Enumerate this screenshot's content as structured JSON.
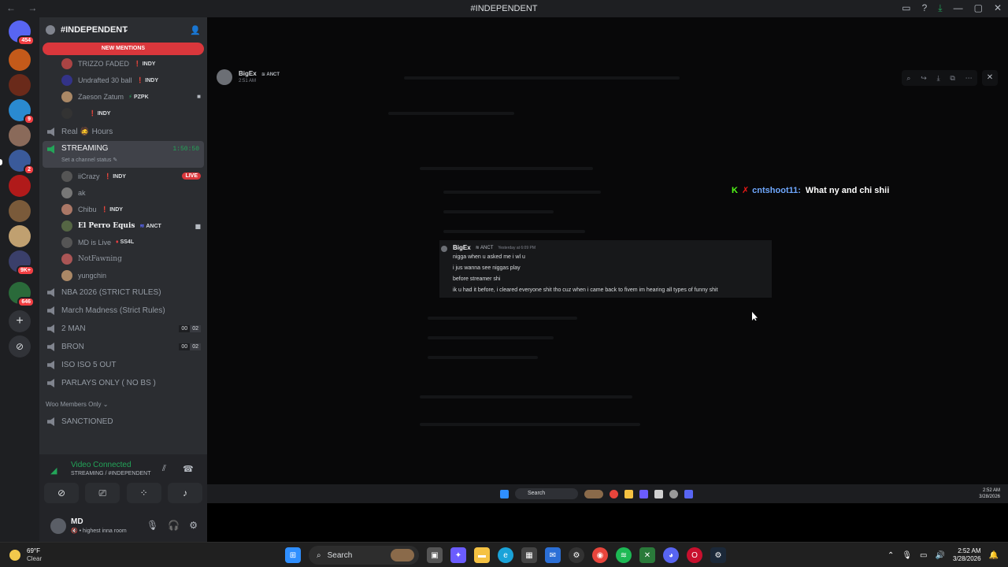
{
  "window": {
    "title": "#INDEPENDENT",
    "nav": "← →"
  },
  "servers": {
    "top_badge": "454",
    "badges": [
      "9",
      "2",
      "9K+",
      "646"
    ],
    "add_icon": "+",
    "discover_icon": "⊘"
  },
  "channel_sidebar": {
    "server_name": "#INDEPENDENT",
    "new_mentions": "NEW MENTIONS",
    "top_users": [
      {
        "name": "TRIZZO FADED",
        "tag": "INDY",
        "color": "#a44"
      },
      {
        "name": "Undrafted 30 ball",
        "tag": "INDY",
        "color": "#338"
      },
      {
        "name": "Zaeson Zatum",
        "tag": "PZPK",
        "color": "#a86"
      },
      {
        "name": "",
        "tag": "INDY",
        "color": "#333"
      }
    ],
    "real_hours": "Real 🧔 Hours",
    "streaming": {
      "name": "STREAMING",
      "status": "Set a channel status ✎",
      "timer": "1:50:50"
    },
    "stream_users": [
      {
        "name": "iiCrazy",
        "tag": "INDY",
        "live": "LIVE",
        "color": "#555"
      },
      {
        "name": "ak",
        "tag": "",
        "color": "#777"
      },
      {
        "name": "Chibu",
        "tag": "INDY",
        "color": "#a76"
      },
      {
        "name": "El Perro Equis",
        "tag": "ANCT",
        "color": "#564"
      },
      {
        "name": "MD is Live",
        "tag": "SS4L",
        "color": "#555"
      },
      {
        "name": "NotFawning",
        "tag": "",
        "color": "#a55"
      },
      {
        "name": "yungchin",
        "tag": "",
        "color": "#a86"
      }
    ],
    "voice_channels": [
      {
        "name": "NBA 2026 (STRICT RULES)"
      },
      {
        "name": "March Madness (Strict Rules)"
      },
      {
        "name": "2 MAN",
        "c1": "00",
        "c2": "02"
      },
      {
        "name": "BRON",
        "c1": "00",
        "c2": "02"
      },
      {
        "name": "ISO ISO 5 OUT"
      },
      {
        "name": "PARLAYS ONLY ( NO BS )"
      }
    ],
    "category": "Woo Members Only ⌄",
    "sanctioned": "SANCTIONED"
  },
  "voice_panel": {
    "status": "Video Connected",
    "location": "STREAMING / #INDEPENDENT",
    "user_name": "MD",
    "user_status": "🔇 • highest inna room"
  },
  "stream": {
    "streamer_name": "BigEx",
    "streamer_tag": "ANCT",
    "streamer_time": "2:51 AM",
    "chat_user": "cntshoot11:",
    "chat_text": "What ny and chi shii",
    "message_card": {
      "author": "BigEx",
      "tag": "ANCT",
      "time": "Yesterday at 6:09 PM",
      "lines": [
        "nigga when u asked me i wl u",
        "i jus wanna see niggas play",
        "before streamer shi",
        "ik u had it before, i cleared everyone shit tho cuz when i came back to fivem im hearing all types of funny shit"
      ]
    },
    "inner_taskbar": {
      "search": "Search",
      "time": "2:52 AM",
      "date": "3/28/2026"
    }
  },
  "taskbar": {
    "weather_temp": "69°F",
    "weather_cond": "Clear",
    "search": "Search",
    "time": "2:52 AM",
    "date": "3/28/2026"
  }
}
